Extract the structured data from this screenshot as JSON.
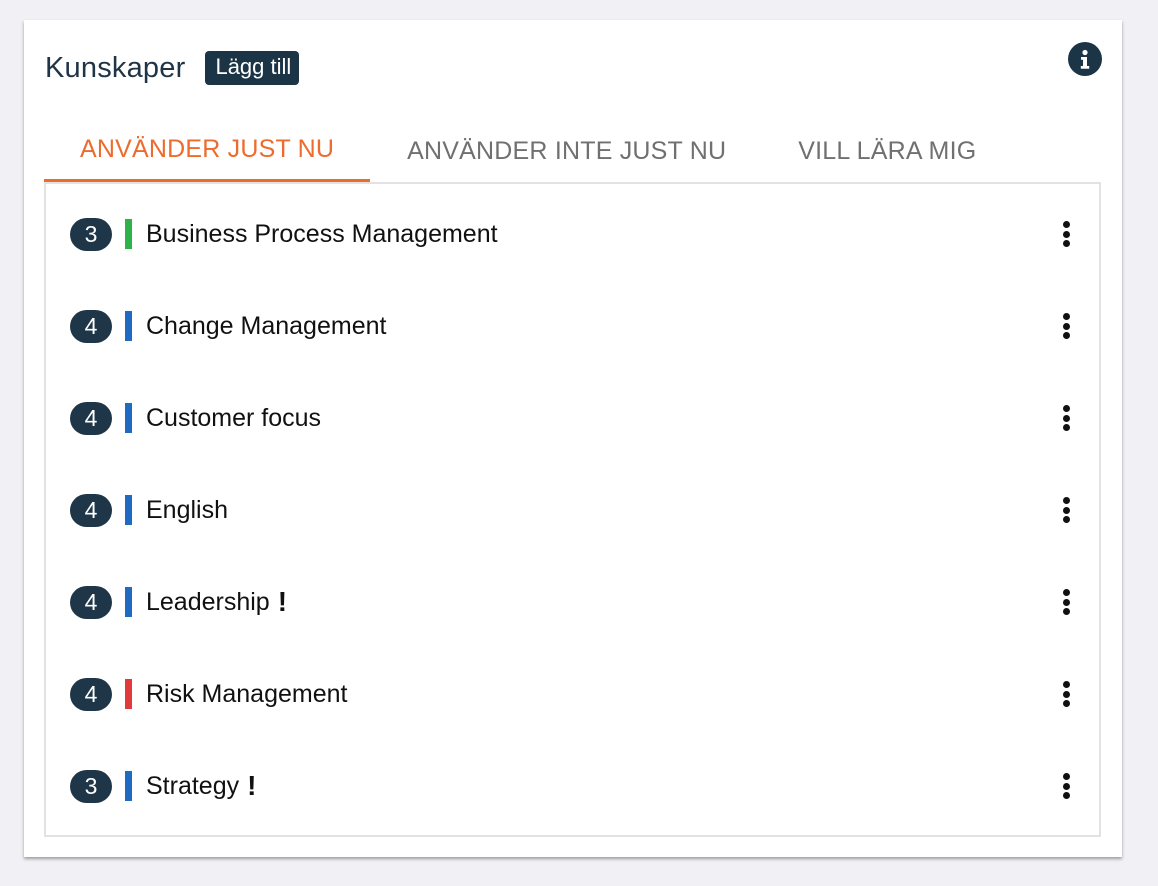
{
  "header": {
    "title": "Kunskaper",
    "add_label": "Lägg till"
  },
  "tabs": [
    {
      "label": "ANVÄNDER JUST NU",
      "active": true
    },
    {
      "label": "ANVÄNDER INTE JUST NU",
      "active": false
    },
    {
      "label": "VILL LÄRA MIG",
      "active": false
    }
  ],
  "skills": [
    {
      "level": "3",
      "name": "Business Process Management",
      "color": "#2db34a",
      "warning": ""
    },
    {
      "level": "4",
      "name": "Change Management",
      "color": "#1f6bc4",
      "warning": ""
    },
    {
      "level": "4",
      "name": "Customer focus",
      "color": "#1f6bc4",
      "warning": ""
    },
    {
      "level": "4",
      "name": "English",
      "color": "#1f6bc4",
      "warning": ""
    },
    {
      "level": "4",
      "name": "Leadership",
      "color": "#1f6bc4",
      "warning": "!"
    },
    {
      "level": "4",
      "name": "Risk Management",
      "color": "#e03a3a",
      "warning": ""
    },
    {
      "level": "3",
      "name": "Strategy",
      "color": "#1f6bc4",
      "warning": "!"
    }
  ],
  "colors": {
    "accent": "#ed6b2d",
    "dark": "#1b3446"
  },
  "icons": {
    "info": "info-icon",
    "row_menu": "kebab-menu-icon"
  }
}
